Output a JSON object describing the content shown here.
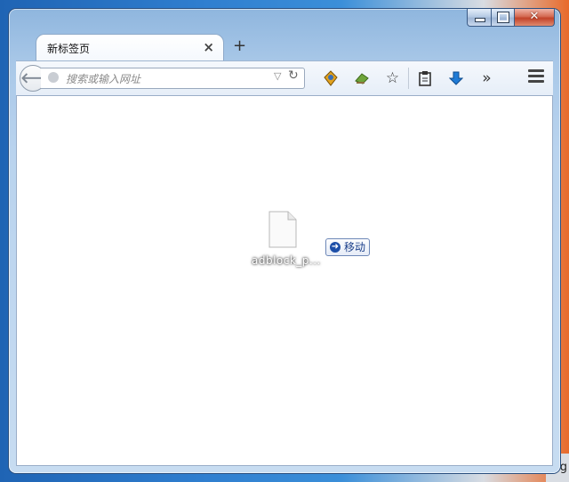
{
  "tab": {
    "title": "新标签页",
    "close": "×",
    "new_tab": "+"
  },
  "urlbar": {
    "placeholder": "搜索或输入网址",
    "value": ""
  },
  "toolbar": {
    "icons": [
      "back-arrow-icon",
      "addon-icon",
      "addon-green-icon",
      "star-icon",
      "reading-list-icon",
      "download-arrow-icon",
      "overflow-chevron-icon",
      "hamburger-menu-icon"
    ],
    "overflow": "»"
  },
  "drag": {
    "file_label": "adblock_p...",
    "action_label": "移动"
  },
  "desktop": {
    "corner_text": "g"
  }
}
